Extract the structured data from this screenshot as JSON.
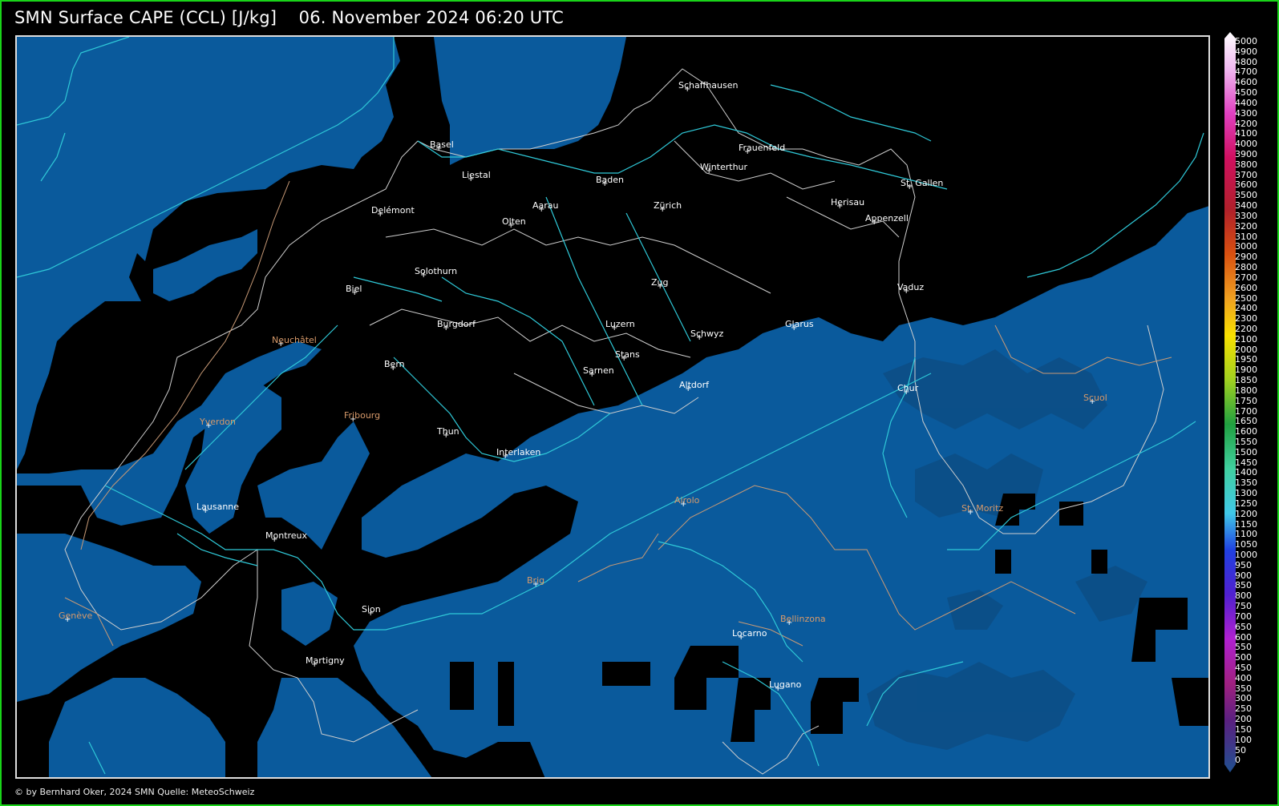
{
  "title": "SMN Surface CAPE (CCL) [J/kg]    06. November 2024 06:20 UTC",
  "footer": "© by Bernhard Oker, 2024  SMN Quelle: MeteoSchweiz",
  "colors": {
    "frame": "#19d419",
    "background": "#000000",
    "cape_fill": "#0a5a9c",
    "cape_fill_dark": "#0d4f8a",
    "rivers": "#2fc9d8",
    "borders": "#cfcfcf",
    "label_white": "#ffffff",
    "label_orange": "#d89a6a"
  },
  "colorbar": {
    "ticks": [
      "5000",
      "4900",
      "4800",
      "4700",
      "4600",
      "4500",
      "4400",
      "4300",
      "4200",
      "4100",
      "4000",
      "3900",
      "3800",
      "3700",
      "3600",
      "3500",
      "3400",
      "3300",
      "3200",
      "3100",
      "3000",
      "2900",
      "2800",
      "2700",
      "2600",
      "2500",
      "2400",
      "2300",
      "2200",
      "2100",
      "2000",
      "1950",
      "1900",
      "1850",
      "1800",
      "1750",
      "1700",
      "1650",
      "1600",
      "1550",
      "1500",
      "1450",
      "1400",
      "1350",
      "1300",
      "1250",
      "1200",
      "1150",
      "1100",
      "1050",
      "1000",
      "950",
      "900",
      "850",
      "800",
      "750",
      "700",
      "650",
      "600",
      "550",
      "500",
      "450",
      "400",
      "350",
      "300",
      "250",
      "200",
      "150",
      "100",
      "50",
      "0"
    ]
  },
  "cities": [
    {
      "name": "Schaffhausen",
      "color": "white"
    },
    {
      "name": "Frauenfeld",
      "color": "white"
    },
    {
      "name": "Basel",
      "color": "white"
    },
    {
      "name": "Liestal",
      "color": "white"
    },
    {
      "name": "Baden",
      "color": "white"
    },
    {
      "name": "Winterthur",
      "color": "white"
    },
    {
      "name": "St. Gallen",
      "color": "white"
    },
    {
      "name": "Herisau",
      "color": "white"
    },
    {
      "name": "Aarau",
      "color": "white"
    },
    {
      "name": "Zürich",
      "color": "white"
    },
    {
      "name": "Delémont",
      "color": "white"
    },
    {
      "name": "Olten",
      "color": "white"
    },
    {
      "name": "Appenzell",
      "color": "white"
    },
    {
      "name": "Solothurn",
      "color": "white"
    },
    {
      "name": "Zug",
      "color": "white"
    },
    {
      "name": "Vaduz",
      "color": "white"
    },
    {
      "name": "Biel",
      "color": "white"
    },
    {
      "name": "Burgdorf",
      "color": "white"
    },
    {
      "name": "Glarus",
      "color": "white"
    },
    {
      "name": "Neuchâtel",
      "color": "orange"
    },
    {
      "name": "Luzern",
      "color": "white"
    },
    {
      "name": "Schwyz",
      "color": "white"
    },
    {
      "name": "Bern",
      "color": "white"
    },
    {
      "name": "Stans",
      "color": "white"
    },
    {
      "name": "Sarnen",
      "color": "white"
    },
    {
      "name": "Altdorf",
      "color": "white"
    },
    {
      "name": "Chur",
      "color": "white"
    },
    {
      "name": "Scuol",
      "color": "orange"
    },
    {
      "name": "Fribourg",
      "color": "orange"
    },
    {
      "name": "Yverdon",
      "color": "orange"
    },
    {
      "name": "Thun",
      "color": "white"
    },
    {
      "name": "Interlaken",
      "color": "white"
    },
    {
      "name": "Airolo",
      "color": "orange"
    },
    {
      "name": "St. Moritz",
      "color": "orange"
    },
    {
      "name": "Lausanne",
      "color": "white"
    },
    {
      "name": "Montreux",
      "color": "white"
    },
    {
      "name": "Brig",
      "color": "orange"
    },
    {
      "name": "Genève",
      "color": "orange"
    },
    {
      "name": "Sion",
      "color": "white"
    },
    {
      "name": "Bellinzona",
      "color": "orange"
    },
    {
      "name": "Locarno",
      "color": "white"
    },
    {
      "name": "Martigny",
      "color": "white"
    },
    {
      "name": "Lugano",
      "color": "white"
    }
  ]
}
